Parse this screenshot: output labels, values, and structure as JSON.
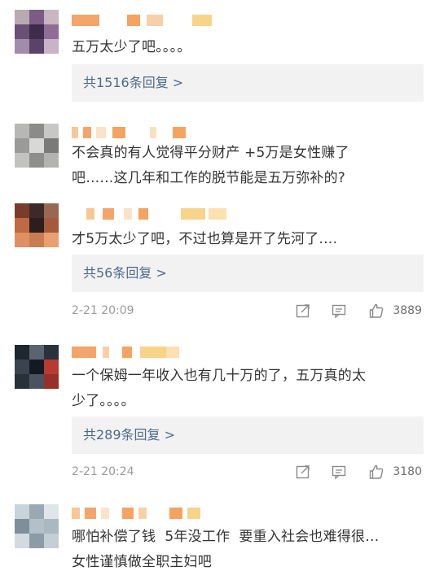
{
  "comments": [
    {
      "text": "五万太少了吧。。。。",
      "replies_label": "共1516条回复 >"
    },
    {
      "text": "不会真的有人觉得平分财产 +5万是女性赚了\n吧……这几年和工作的脱节能是五万弥补的?"
    },
    {
      "text": "才5万太少了吧，不过也算是开了先河了….",
      "replies_label": "共56条回复 >",
      "time": "2-21 20:09",
      "likes": "3889"
    },
    {
      "text": "一个保姆一年收入也有几十万的了，五万真的太\n少了。。。。",
      "replies_label": "共289条回复 >",
      "time": "2-21 20:24",
      "likes": "3180"
    },
    {
      "text": "哪怕补偿了钱  5年没工作  要重入社会也难得很…\n女性谨慎做全职主妇吧"
    }
  ],
  "icons": {
    "share": "share-icon",
    "comment": "comment-icon",
    "like": "like-icon"
  },
  "colors": {
    "reply_link": "#4e6a8a",
    "reply_bg": "#f2f2f2",
    "timestamp": "#9a9a9a",
    "body_text": "#333333"
  }
}
